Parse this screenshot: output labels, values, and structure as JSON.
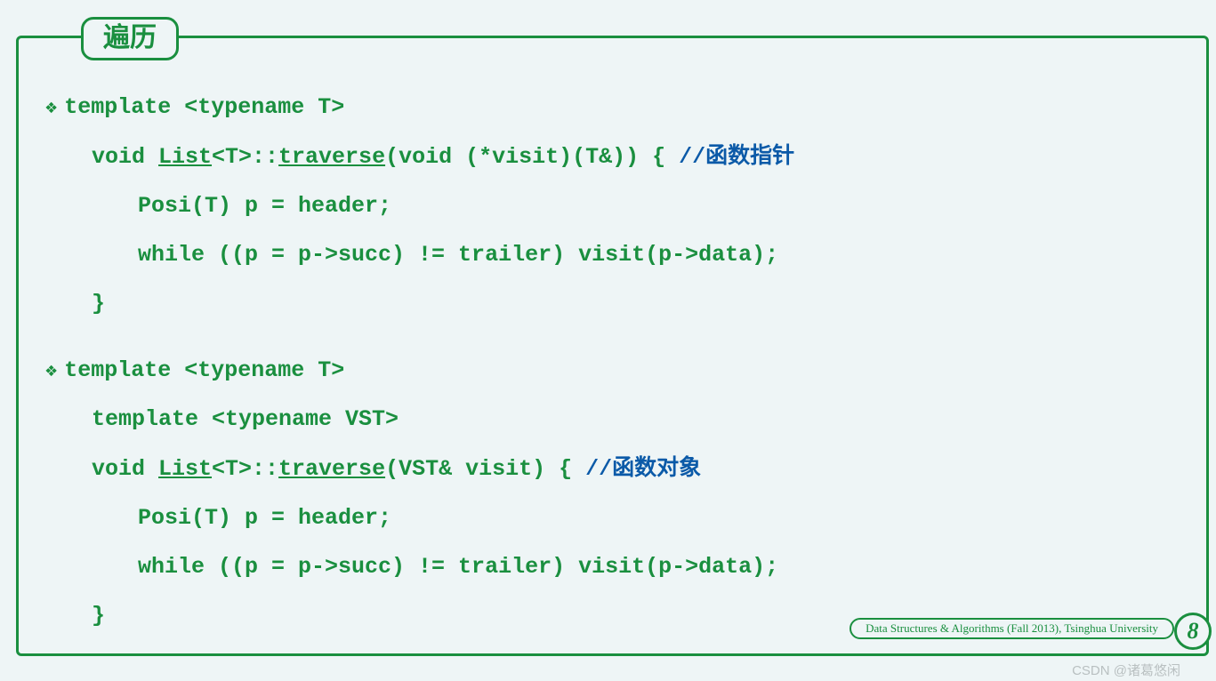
{
  "title": "遍历",
  "block1": {
    "l1": "template <typename T>",
    "l2a": "void ",
    "l2b": "List",
    "l2c": "<T>::",
    "l2d": "traverse",
    "l2e": "(void (*visit)(T&)) { ",
    "l2f": "//函数指针",
    "l3": "Posi(T) p = header;",
    "l4": "while ((p = p->succ) != trailer) visit(p->data);",
    "l5": "}"
  },
  "block2": {
    "l1": "template <typename T>",
    "l2": "template <typename VST>",
    "l3a": "void ",
    "l3b": "List",
    "l3c": "<T>::",
    "l3d": "traverse",
    "l3e": "(VST& visit) { ",
    "l3f": "//函数对象",
    "l4": "Posi(T) p = header;",
    "l5": "while ((p = p->succ) != trailer) visit(p->data);",
    "l6": "}"
  },
  "footer": "Data Structures & Algorithms (Fall 2013), Tsinghua University",
  "page": "8",
  "watermark": "CSDN @诸葛悠闲"
}
